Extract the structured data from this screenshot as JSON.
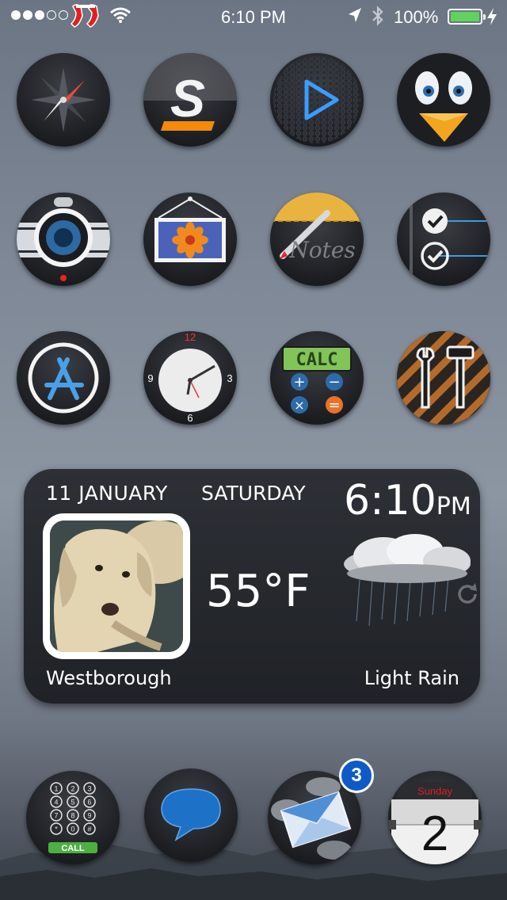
{
  "status_bar": {
    "time": "6:10 PM",
    "battery_pct": "100%",
    "battery_level": 1.0,
    "signal_bars_filled": 3,
    "signal_bars_total": 5,
    "carrier_icon": "red-sox-logo",
    "battery_color": "#5fd35b"
  },
  "apps": [
    {
      "name": "safari-icon"
    },
    {
      "name": "s-app-icon"
    },
    {
      "name": "video-player-icon"
    },
    {
      "name": "penguin-app-icon"
    },
    {
      "name": "camera-icon"
    },
    {
      "name": "photos-icon"
    },
    {
      "name": "notes-icon",
      "label": "Notes"
    },
    {
      "name": "reminders-icon"
    },
    {
      "name": "app-store-icon"
    },
    {
      "name": "clock-icon",
      "numerals": [
        "12",
        "3",
        "6",
        "9"
      ]
    },
    {
      "name": "calculator-icon",
      "label": "CALC"
    },
    {
      "name": "settings-icon"
    }
  ],
  "widget": {
    "date": "11 JANUARY",
    "day": "SATURDAY",
    "time": "6:10",
    "ampm": "PM",
    "temperature": "55°F",
    "location": "Westborough",
    "condition": "Light Rain"
  },
  "dock": {
    "phone_label": "CALL",
    "keypad": [
      "1",
      "2",
      "3",
      "4",
      "5",
      "6",
      "7",
      "8",
      "9",
      "*",
      "0",
      "#"
    ],
    "mail_badge": "3",
    "calendar_day_name": "Sunday",
    "calendar_day_number": "2"
  }
}
